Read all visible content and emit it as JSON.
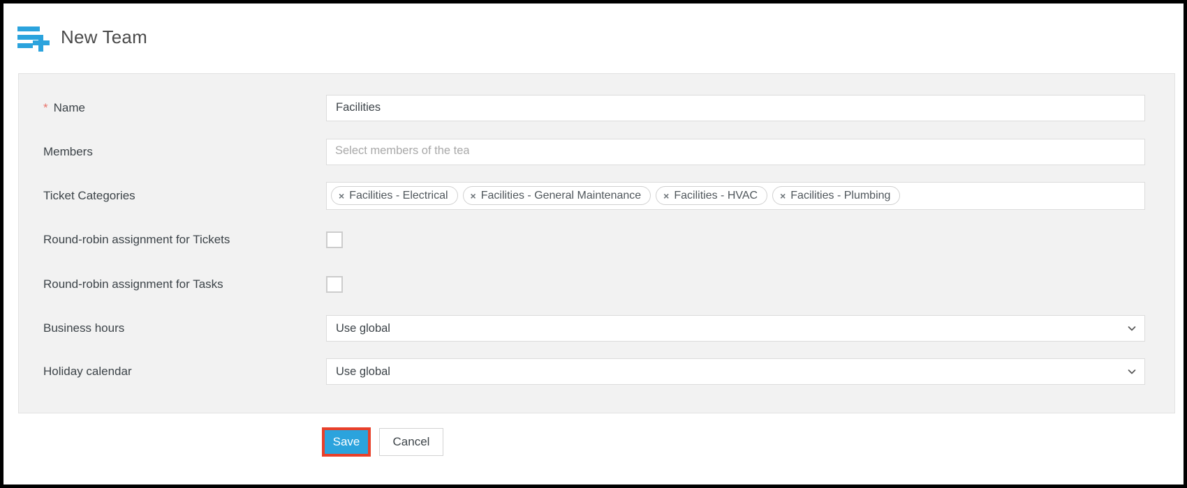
{
  "header": {
    "icon": "new-team-list-plus-icon",
    "title": "New Team"
  },
  "form": {
    "fields": {
      "name": {
        "label": "Name",
        "required_marker": "*",
        "value": "Facilities"
      },
      "members": {
        "label": "Members",
        "value": "",
        "placeholder": "Select members of the team"
      },
      "ticket_categories": {
        "label": "Ticket Categories",
        "remove_glyph": "×",
        "tags": [
          "Facilities - Electrical",
          "Facilities - General Maintenance",
          "Facilities - HVAC",
          "Facilities - Plumbing"
        ]
      },
      "round_robin_tickets": {
        "label": "Round-robin assignment for Tickets",
        "checked": false
      },
      "round_robin_tasks": {
        "label": "Round-robin assignment for Tasks",
        "checked": false
      },
      "business_hours": {
        "label": "Business hours",
        "value": "Use global",
        "options": [
          "Use global"
        ]
      },
      "holiday_calendar": {
        "label": "Holiday calendar",
        "value": "Use global",
        "options": [
          "Use global"
        ]
      }
    }
  },
  "actions": {
    "save_label": "Save",
    "cancel_label": "Cancel"
  },
  "colors": {
    "accent_blue": "#2BA3DD",
    "highlight_red": "#E8402A",
    "required_star": "#E8736A",
    "panel_bg": "#F2F2F2"
  }
}
